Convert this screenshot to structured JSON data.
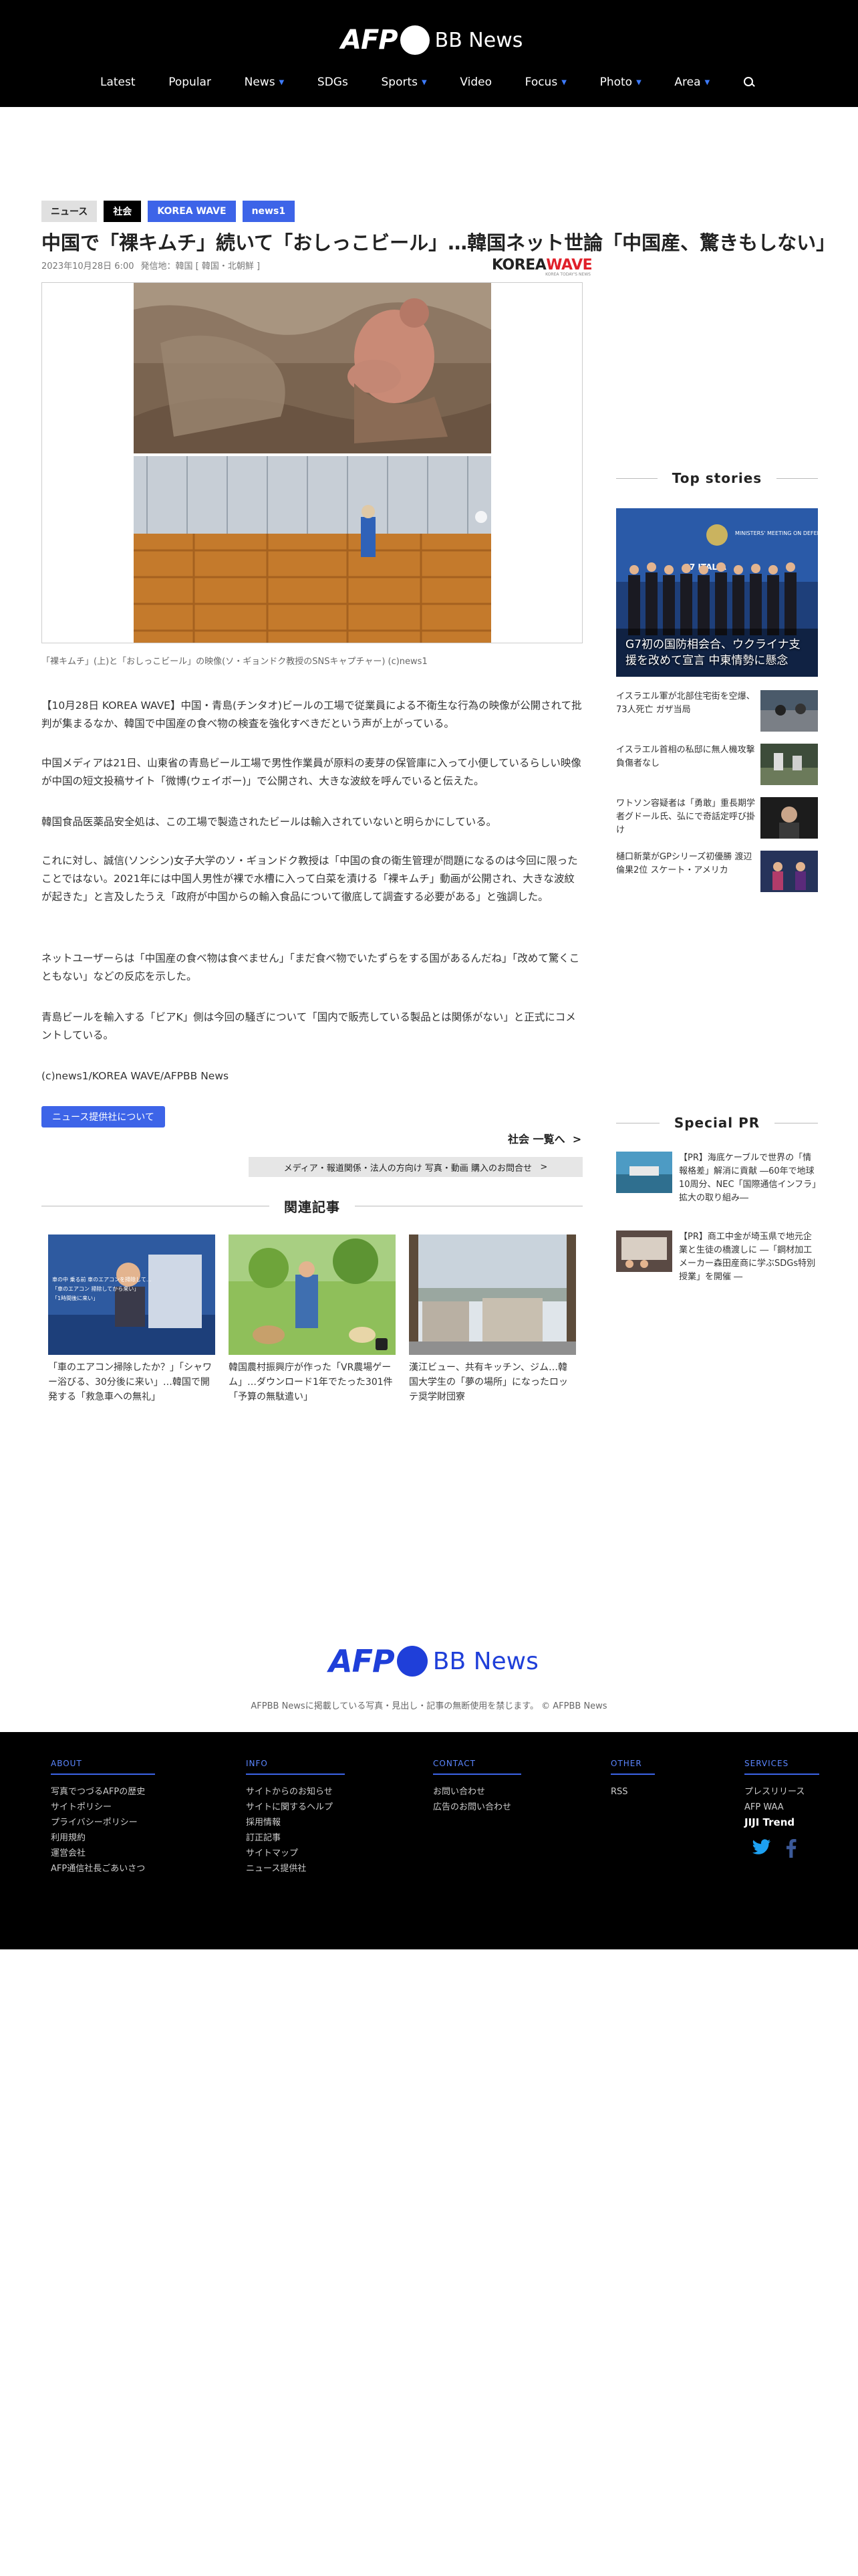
{
  "header": {
    "logo_text_afp": "AFP",
    "logo_text_bb": "BB News",
    "nav": [
      {
        "label": "Latest",
        "dropdown": false
      },
      {
        "label": "Popular",
        "dropdown": false
      },
      {
        "label": "News",
        "dropdown": true
      },
      {
        "label": "SDGs",
        "dropdown": false
      },
      {
        "label": "Sports",
        "dropdown": true
      },
      {
        "label": "Video",
        "dropdown": false
      },
      {
        "label": "Focus",
        "dropdown": true
      },
      {
        "label": "Photo",
        "dropdown": true
      },
      {
        "label": "Area",
        "dropdown": true
      }
    ],
    "search_icon": "search-icon"
  },
  "article": {
    "tags": [
      "ニュース",
      "社会",
      "KOREA WAVE",
      "news1"
    ],
    "title": "中国で「裸キムチ」続いて「おしっこビール」…韓国ネット世論「中国産、驚きもしない」",
    "date": "2023年10月28日 6:00",
    "origin": "発信地：韓国 [ 韓国・北朝鮮 ]",
    "source_logo_main": "KOREA",
    "source_logo_accent": "WAVE",
    "source_logo_sub": "KOREA TODAY'S NEWS",
    "caption": "「裸キムチ」(上)と「おしっこビール」の映像(ソ・ギョンドク教授のSNSキャプチャー) (c)news1",
    "paragraphs": [
      "【10月28日 KOREA WAVE】中国・青島(チンタオ)ビールの工場で従業員による不衛生な行為の映像が公開されて批判が集まるなか、韓国で中国産の食べ物の検査を強化すべきだという声が上がっている。",
      "中国メディアは21日、山東省の青島ビール工場で男性作業員が原料の麦芽の保管庫に入って小便しているらしい映像が中国の短文投稿サイト「微博(ウェイボー)」で公開され、大きな波紋を呼んでいると伝えた。",
      "韓国食品医薬品安全処は、この工場で製造されたビールは輸入されていないと明らかにしている。",
      "これに対し、誠信(ソンシン)女子大学のソ・ギョンドク教授は「中国の食の衛生管理が問題になるのは今回に限ったことではない。2021年には中国人男性が裸で水槽に入って白菜を漬ける「裸キムチ」動画が公開され、大きな波紋が起きた」と言及したうえ「政府が中国からの輸入食品について徹底して調査する必要がある」と強調した。",
      "ネットユーザーらは「中国産の食べ物は食べません」「まだ食べ物でいたずらをする国があるんだね」「改めて驚くこともない」などの反応を示した。",
      "青島ビールを輸入する「ビアK」側は今回の騒ぎについて「国内で販売している製品とは関係がない」と正式にコメントしている。",
      "(c)news1/KOREA WAVE/AFPBB News"
    ],
    "provider_button": "ニュース提供社について",
    "category_link": "社会 一覧へ",
    "category_arrow": ">",
    "media_banner": "メディア・報道関係・法人の方向け 写真・動画 購入のお問合せ",
    "media_banner_arrow": ">"
  },
  "related": {
    "heading": "関連記事",
    "items": [
      {
        "text": "「車のエアコン掃除したか？」「シャワー浴びる、30分後に来い」…韓国で開発する「救急車への無礼」"
      },
      {
        "text": "韓国農村振興庁が作った「VR農場ゲーム」…ダウンロード1年でたった301件「予算の無駄遣い」"
      },
      {
        "text": "漢江ビュー、共有キッチン、ジム…韓国大学生の「夢の場所」になったロッテ奨学財団寮"
      }
    ],
    "thumb1_overlay": [
      "車の中 乗る前 車のエアコンを掃除して…",
      "「車のエアコン 掃除してから来い」",
      "「1時間後に来い」"
    ]
  },
  "sidebar": {
    "top_stories_heading": "Top stories",
    "main_story": {
      "caption": "G7初の国防相会合、ウクライナ支援を改めて宣言 中東情勢に懸念",
      "banner_text": "MINISTERS' MEETING ON DEFENCE",
      "banner_sub": "G7 ITALIA"
    },
    "stories": [
      {
        "text": "イスラエル軍が北部住宅街を空爆、73人死亡 ガザ当局"
      },
      {
        "text": "イスラエル首相の私邸に無人機攻撃 負傷者なし"
      },
      {
        "text": "ワトソン容疑者は「勇敢」重長期学者グドール氏、弘にで奇話定呼び掛け"
      },
      {
        "text": "樋口新葉がGPシリーズ初優勝 渡辺倫果2位 スケート・アメリカ"
      }
    ],
    "special_pr_heading": "Special PR",
    "pr_items": [
      {
        "text": "【PR】海底ケーブルで世界の「情報格差」解消に貢献 ―60年で地球10周分、NEC「国際通信インフラ」拡大の取り組み―"
      },
      {
        "text": "【PR】商工中金が埼玉県で地元企業と生徒の橋渡しに ―「鋼材加工メーカー森田産商に学ぶSDGs特別授業」を開催 ―"
      }
    ]
  },
  "footer": {
    "logo_text_afp": "AFP",
    "logo_text_bb": "BB News",
    "copyright": "AFPBB Newsに掲載している写真・見出し・記事の無断使用を禁じます。 © AFPBB News",
    "columns": [
      {
        "title": "ABOUT",
        "items": [
          "写真でつづるAFPの歴史",
          "サイトポリシー",
          "プライバシーポリシー",
          "利用規約",
          "運営会社",
          "AFP通信社長ごあいさつ"
        ]
      },
      {
        "title": "INFO",
        "items": [
          "サイトからのお知らせ",
          "サイトに関するヘルプ",
          "採用情報",
          "訂正記事",
          "サイトマップ",
          "ニュース提供社"
        ]
      },
      {
        "title": "CONTACT",
        "items": [
          "お問い合わせ",
          "広告のお問い合わせ"
        ]
      },
      {
        "title": "OTHER",
        "items": [
          "RSS"
        ]
      },
      {
        "title": "SERVICES",
        "items": [
          "プレスリリース",
          "AFP WAA"
        ]
      }
    ],
    "jiji_logo": "JIJI Trend",
    "social_icons": [
      "twitter-icon",
      "facebook-icon"
    ]
  },
  "colors": {
    "accent_blue": "#3d64e8",
    "brand_blue": "#1f3fd9",
    "header_bg": "#000000",
    "kw_red": "#e0202a"
  }
}
